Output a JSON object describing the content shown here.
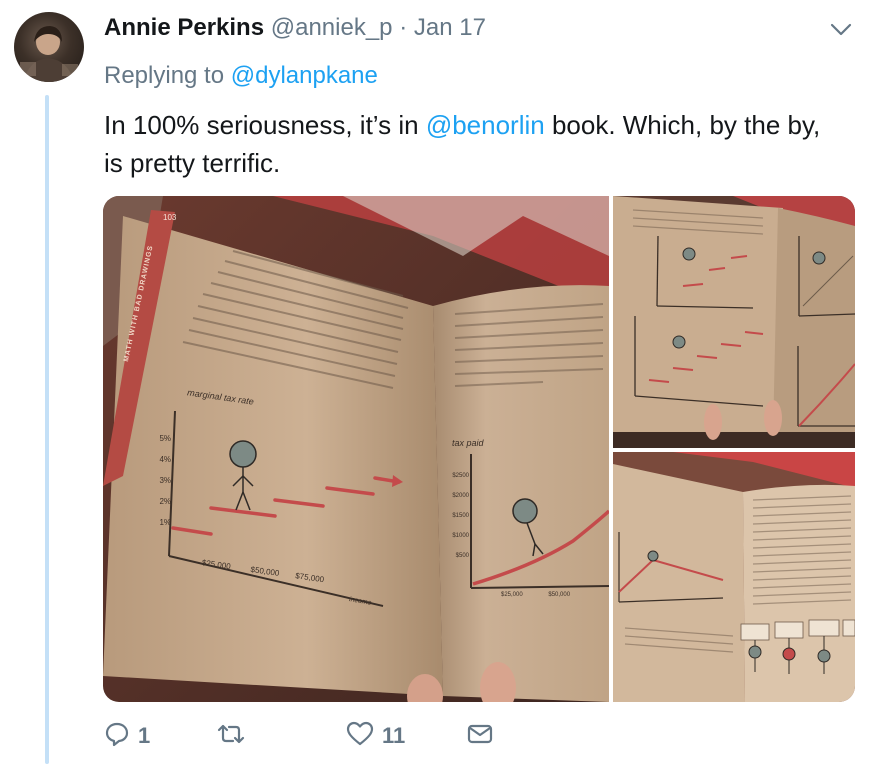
{
  "tweet": {
    "author_name": "Annie Perkins",
    "handle": "@anniek_p",
    "separator": "·",
    "date": "Jan 17",
    "replying_prefix": "Replying to",
    "replying_to": "@dylanpkane",
    "text_before": "In 100% seriousness, it’s in ",
    "mention": "@benorlin",
    "text_after": " book. Which, by the by, is pretty terrific."
  },
  "media": {
    "photo1": {
      "page_number": "103",
      "spine_text": "MATH WITH BAD DRAWINGS",
      "left_graph": {
        "ylabel": "marginal tax rate",
        "xlabel": "income",
        "yticks": [
          "5%",
          "4%",
          "3%",
          "2%",
          "1%"
        ],
        "xticks": [
          "$25,000",
          "$50,000",
          "$75,000"
        ]
      },
      "right_graph": {
        "ylabel": "tax paid",
        "yticks": [
          "$2500",
          "$2000",
          "$1500",
          "$1000",
          "$500"
        ],
        "xticks": [
          "$25,000",
          "$50,000"
        ]
      }
    }
  },
  "actions": {
    "reply_count": "1",
    "retweet_count": "",
    "like_count": "11"
  },
  "colors": {
    "link": "#1da1f2",
    "secondary_text": "#657786",
    "thread_line": "#c4e0f7"
  },
  "icons": {
    "chevron": "chevron-down-icon",
    "reply": "reply-icon",
    "retweet": "retweet-icon",
    "like": "heart-icon",
    "dm": "envelope-icon"
  }
}
